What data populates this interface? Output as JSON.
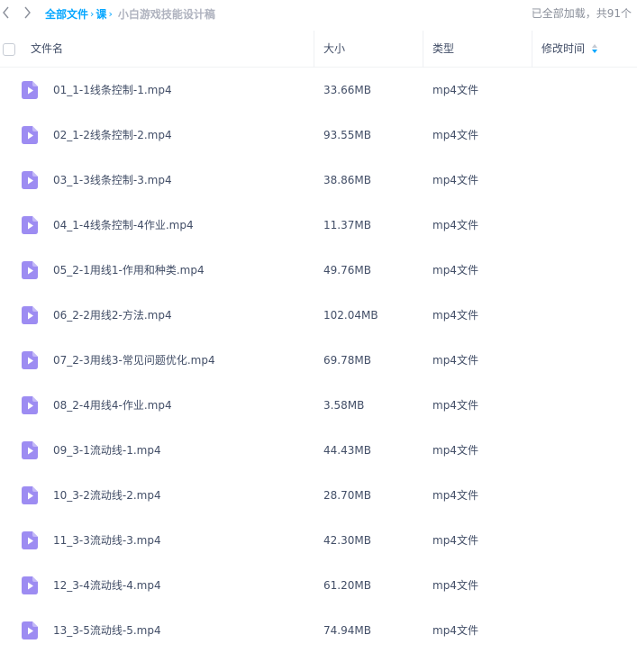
{
  "breadcrumb": {
    "root": "全部文件",
    "sep1": "›",
    "folder": "课",
    "sep2": "›",
    "current": "小白游戏技能设计稿"
  },
  "status": "已全部加载，共91个",
  "columns": {
    "name": "文件名",
    "size": "大小",
    "type": "类型",
    "modified": "修改时间"
  },
  "colors": {
    "accent": "#06a7ff",
    "icon": "#9d8cf2"
  },
  "files": [
    {
      "name": "01_1-1线条控制-1.mp4",
      "size": "33.66MB",
      "type": "mp4文件"
    },
    {
      "name": "02_1-2线条控制-2.mp4",
      "size": "93.55MB",
      "type": "mp4文件"
    },
    {
      "name": "03_1-3线条控制-3.mp4",
      "size": "38.86MB",
      "type": "mp4文件"
    },
    {
      "name": "04_1-4线条控制-4作业.mp4",
      "size": "11.37MB",
      "type": "mp4文件"
    },
    {
      "name": "05_2-1用线1-作用和种类.mp4",
      "size": "49.76MB",
      "type": "mp4文件"
    },
    {
      "name": "06_2-2用线2-方法.mp4",
      "size": "102.04MB",
      "type": "mp4文件"
    },
    {
      "name": "07_2-3用线3-常见问题优化.mp4",
      "size": "69.78MB",
      "type": "mp4文件"
    },
    {
      "name": "08_2-4用线4-作业.mp4",
      "size": "3.58MB",
      "type": "mp4文件"
    },
    {
      "name": "09_3-1流动线-1.mp4",
      "size": "44.43MB",
      "type": "mp4文件"
    },
    {
      "name": "10_3-2流动线-2.mp4",
      "size": "28.70MB",
      "type": "mp4文件"
    },
    {
      "name": "11_3-3流动线-3.mp4",
      "size": "42.30MB",
      "type": "mp4文件"
    },
    {
      "name": "12_3-4流动线-4.mp4",
      "size": "61.20MB",
      "type": "mp4文件"
    },
    {
      "name": "13_3-5流动线-5.mp4",
      "size": "74.94MB",
      "type": "mp4文件"
    }
  ]
}
